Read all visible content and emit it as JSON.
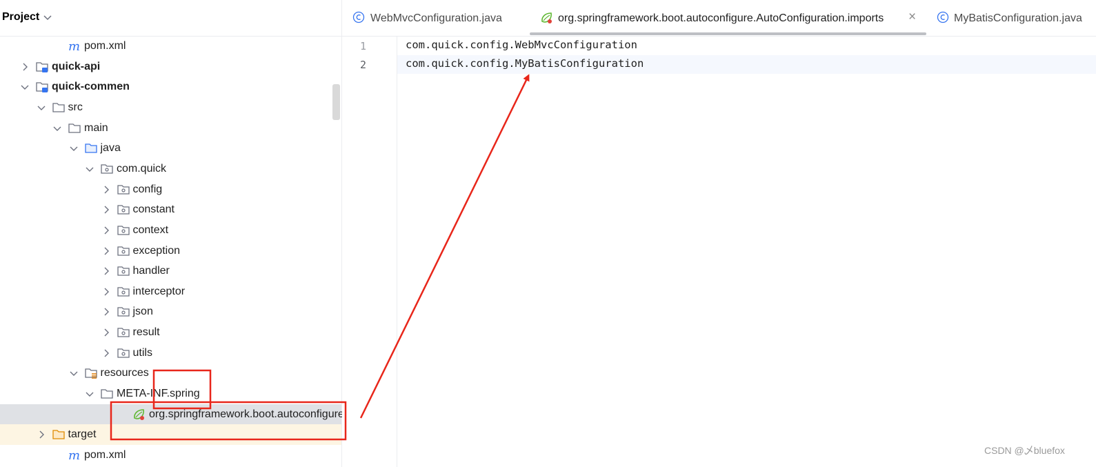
{
  "panel": {
    "title": "Project"
  },
  "tree": [
    {
      "label": "pom.xml",
      "icon": "maven-icon",
      "depth": 3,
      "arrow": "none",
      "bold": false
    },
    {
      "label": "quick-api",
      "icon": "module-icon",
      "depth": 1,
      "arrow": "right",
      "bold": true
    },
    {
      "label": "quick-commen",
      "icon": "module-icon",
      "depth": 1,
      "arrow": "down",
      "bold": true
    },
    {
      "label": "src",
      "icon": "folder-icon",
      "depth": 2,
      "arrow": "down",
      "bold": false
    },
    {
      "label": "main",
      "icon": "folder-icon",
      "depth": 3,
      "arrow": "down",
      "bold": false
    },
    {
      "label": "java",
      "icon": "source-folder-icon",
      "depth": 4,
      "arrow": "down",
      "bold": false
    },
    {
      "label": "com.quick",
      "icon": "package-icon",
      "depth": 5,
      "arrow": "down",
      "bold": false
    },
    {
      "label": "config",
      "icon": "package-icon",
      "depth": 6,
      "arrow": "right",
      "bold": false
    },
    {
      "label": "constant",
      "icon": "package-icon",
      "depth": 6,
      "arrow": "right",
      "bold": false
    },
    {
      "label": "context",
      "icon": "package-icon",
      "depth": 6,
      "arrow": "right",
      "bold": false
    },
    {
      "label": "exception",
      "icon": "package-icon",
      "depth": 6,
      "arrow": "right",
      "bold": false
    },
    {
      "label": "handler",
      "icon": "package-icon",
      "depth": 6,
      "arrow": "right",
      "bold": false
    },
    {
      "label": "interceptor",
      "icon": "package-icon",
      "depth": 6,
      "arrow": "right",
      "bold": false
    },
    {
      "label": "json",
      "icon": "package-icon",
      "depth": 6,
      "arrow": "right",
      "bold": false
    },
    {
      "label": "result",
      "icon": "package-icon",
      "depth": 6,
      "arrow": "right",
      "bold": false
    },
    {
      "label": "utils",
      "icon": "package-icon",
      "depth": 6,
      "arrow": "right",
      "bold": false
    },
    {
      "label": "resources",
      "icon": "resources-folder-icon",
      "depth": 4,
      "arrow": "down",
      "bold": false
    },
    {
      "label": "META-INF.spring",
      "icon": "folder-icon",
      "depth": 5,
      "arrow": "down",
      "bold": false
    },
    {
      "label": "org.springframework.boot.autoconfigure.",
      "icon": "spring-icon",
      "depth": 7,
      "arrow": "none",
      "bold": false,
      "state": "selected"
    },
    {
      "label": "target",
      "icon": "excluded-folder-icon",
      "depth": 2,
      "arrow": "right",
      "bold": false,
      "state": "excluded"
    },
    {
      "label": "pom.xml",
      "icon": "maven-icon",
      "depth": 3,
      "arrow": "none",
      "bold": false
    }
  ],
  "tabs": [
    {
      "label": "WebMvcConfiguration.java",
      "icon": "java-class-icon",
      "active": false
    },
    {
      "label": "org.springframework.boot.autoconfigure.AutoConfiguration.imports",
      "icon": "spring-icon",
      "active": true,
      "close": "×"
    },
    {
      "label": "MyBatisConfiguration.java",
      "icon": "java-class-icon",
      "active": false
    }
  ],
  "editor": {
    "lines": [
      {
        "number": "1",
        "text": "com.quick.config.WebMvcConfiguration"
      },
      {
        "number": "2",
        "text": "com.quick.config.MyBatisConfiguration"
      }
    ],
    "current_line": 2
  },
  "watermark": "CSDN @乄bluefox",
  "colors": {
    "annotation_red": "#e8261a",
    "excluded_row": "#fdf5e3",
    "selected_row": "#dfe1e5",
    "folder": "#6c707e",
    "module_blue": "#3574f0",
    "spring_green": "#5fb832"
  }
}
